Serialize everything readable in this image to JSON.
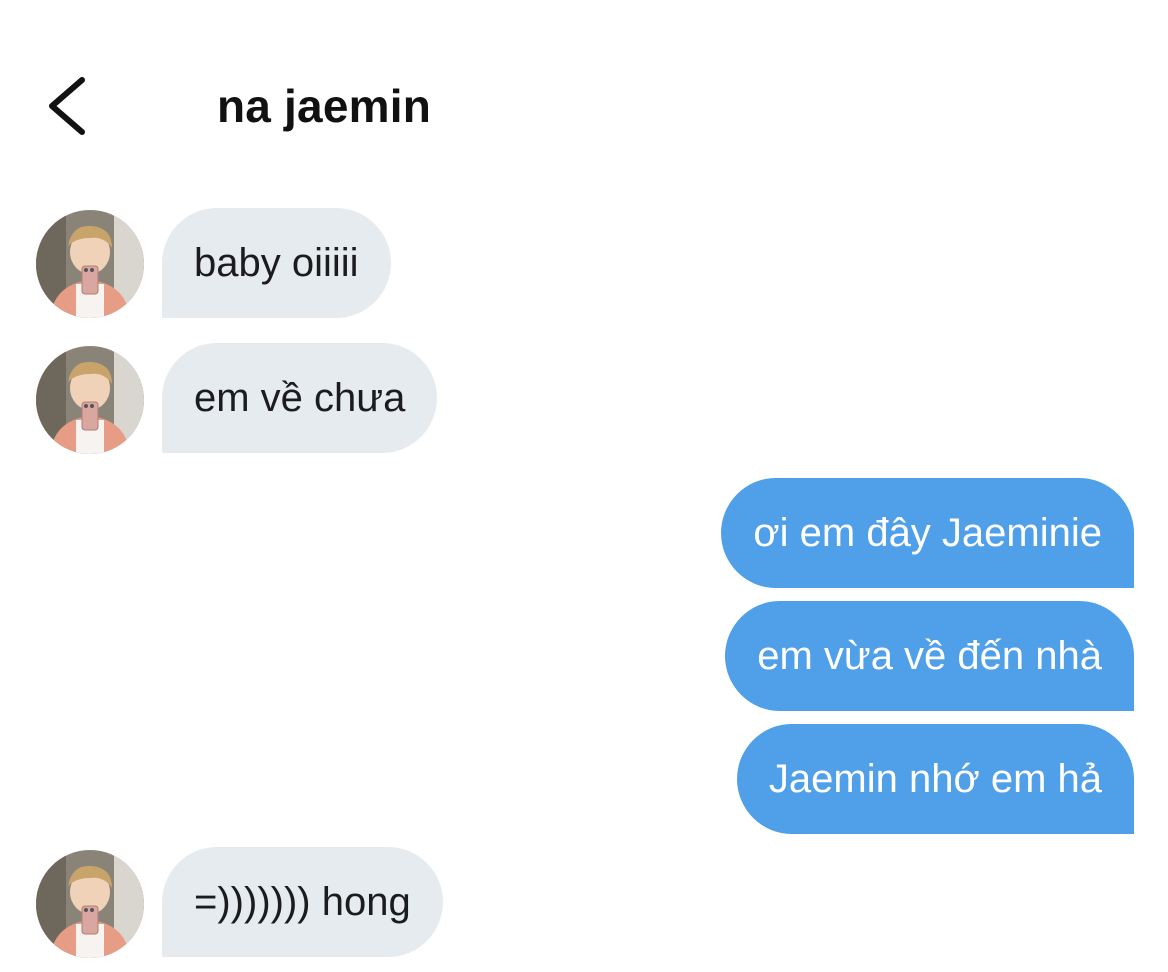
{
  "header": {
    "title": "na jaemin",
    "back_icon": "chevron-left-icon"
  },
  "messages": [
    {
      "sender": "them",
      "text": "baby oiiiii"
    },
    {
      "sender": "them",
      "text": "em về chưa"
    },
    {
      "sender": "me",
      "text": "ơi em đây Jaeminie"
    },
    {
      "sender": "me",
      "text": "em vừa về đến nhà"
    },
    {
      "sender": "me",
      "text": "Jaemin nhớ em hả"
    },
    {
      "sender": "them",
      "text": "=))))))) hong"
    }
  ],
  "colors": {
    "incoming_bubble": "#e6ebef",
    "outgoing_bubble": "#4f9fe9",
    "outgoing_text": "#ffffff",
    "incoming_text": "#1c1c1e"
  }
}
